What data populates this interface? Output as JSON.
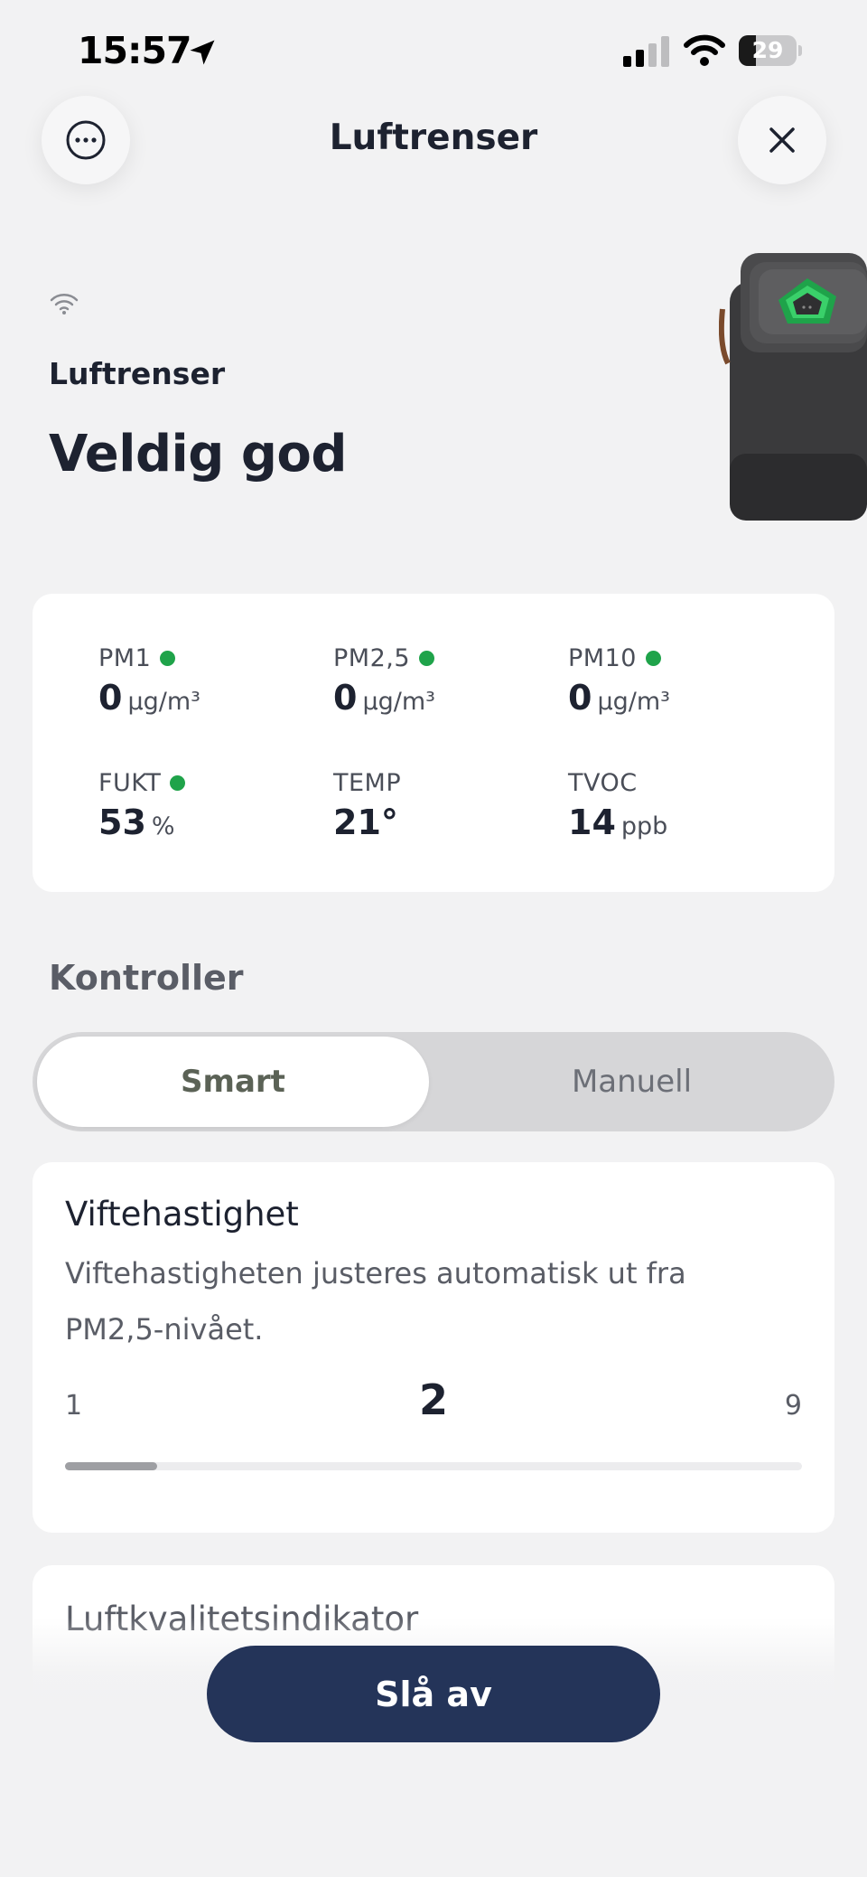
{
  "status_bar": {
    "time": "15:57",
    "battery": "29",
    "battery_level": 0.29
  },
  "nav": {
    "title": "Luftrenser",
    "menu_icon": "more-icon",
    "close_icon": "close-icon"
  },
  "device": {
    "name": "Luftrenser",
    "status": "Veldig god"
  },
  "metrics": [
    {
      "label": "PM1",
      "value": "0",
      "unit": "μg/m³",
      "indicator": true
    },
    {
      "label": "PM2,5",
      "value": "0",
      "unit": "μg/m³",
      "indicator": true
    },
    {
      "label": "PM10",
      "value": "0",
      "unit": "μg/m³",
      "indicator": true
    },
    {
      "label": "FUKT",
      "value": "53",
      "unit": "%",
      "indicator": true
    },
    {
      "label": "TEMP",
      "value": "21°",
      "unit": "",
      "indicator": false
    },
    {
      "label": "TVOC",
      "value": "14",
      "unit": "ppb",
      "indicator": false
    }
  ],
  "controls": {
    "title": "Kontroller",
    "modes": [
      "Smart",
      "Manuell"
    ],
    "selected_mode": "Smart"
  },
  "fan": {
    "title": "Viftehastighet",
    "description": "Viftehastigheten justeres automatisk ut fra PM2,5-nivået.",
    "min": "1",
    "max": "9",
    "value": "2",
    "level": 2
  },
  "air_quality_indicator": {
    "title": "Luftkvalitetsindikator"
  },
  "actions": {
    "off_label": "Slå av"
  },
  "colors": {
    "accent": "#243459",
    "good": "#1fa34a",
    "background": "#f2f2f3"
  }
}
